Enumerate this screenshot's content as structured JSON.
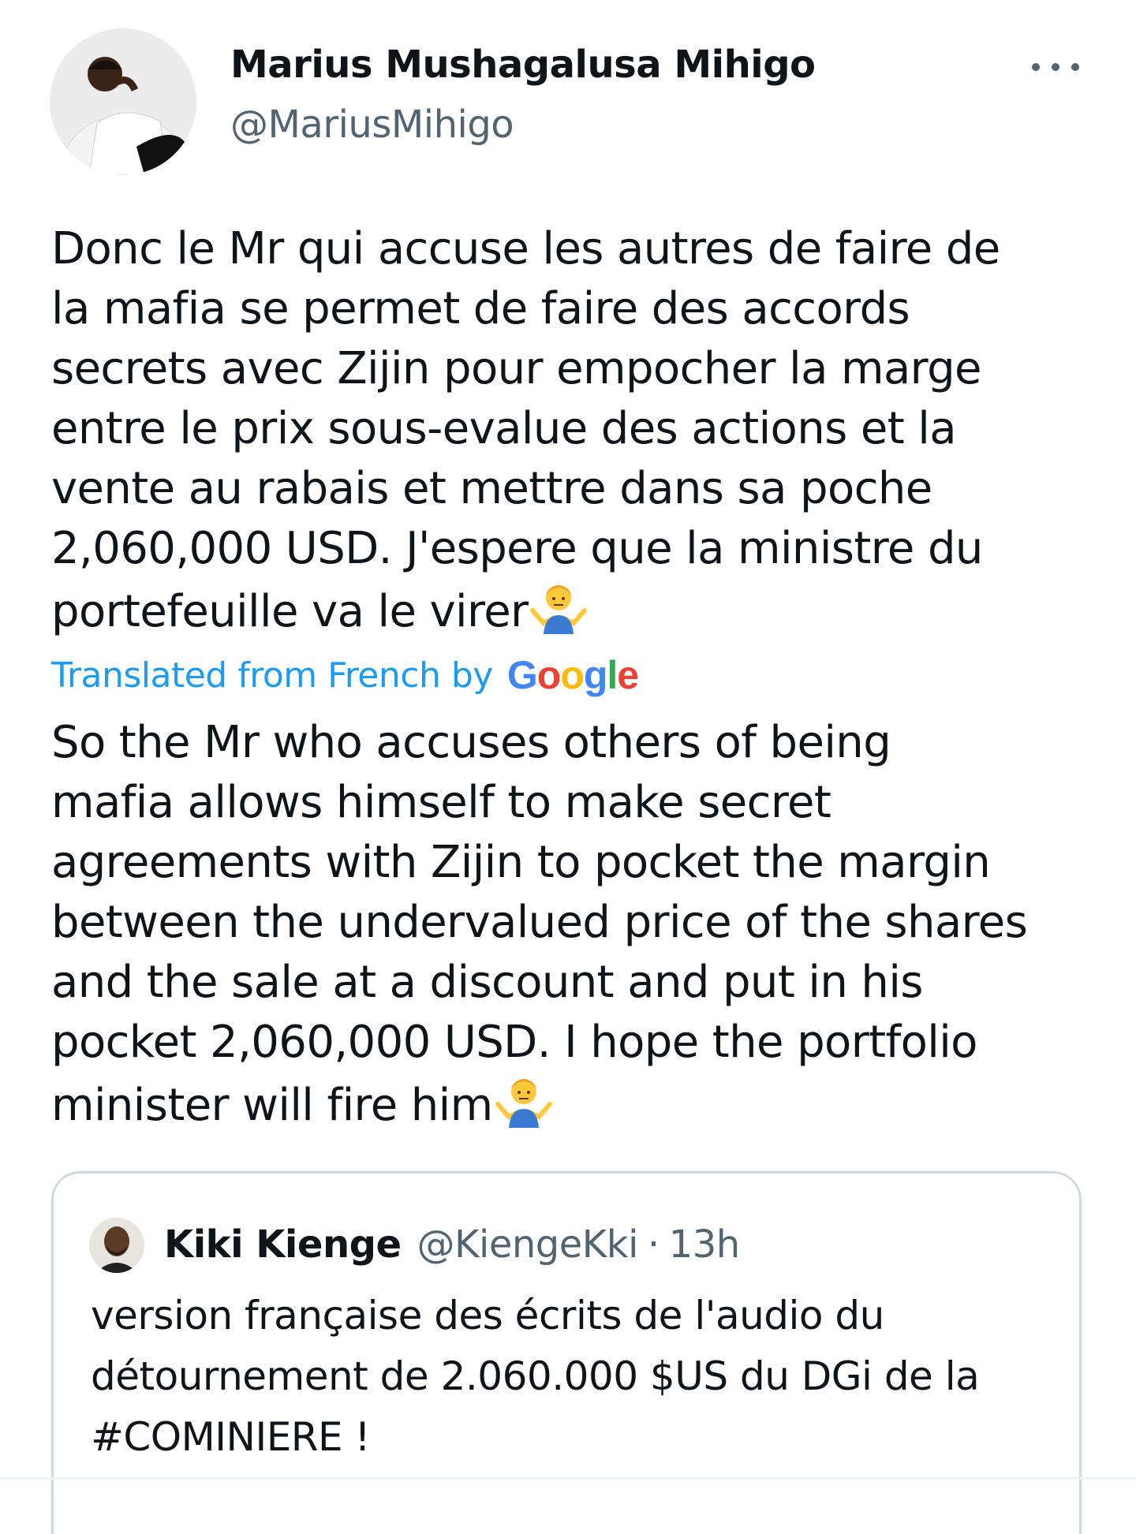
{
  "tweet": {
    "author_name": "Marius Mushagalusa Mihigo",
    "author_handle": "@MariusMihigo",
    "more_icon": "ellipsis-icon",
    "original_text": "Donc le Mr qui accuse les autres de faire de\nla mafia se permet de faire des accords\nsecrets avec Zijin pour empocher la marge\nentre le prix sous-evalue des actions et la\nvente au rabais et mettre dans sa poche\n2,060,000 USD. J'espere que la ministre du\nportefeuille va le virer",
    "translation_label": "Translated from French by",
    "google_logo": {
      "letters": [
        "G",
        "o",
        "o",
        "g",
        "l",
        "e"
      ],
      "colors": [
        "#4285F4",
        "#EA4335",
        "#FBBC05",
        "#4285F4",
        "#34A853",
        "#EA4335"
      ]
    },
    "translated_text": "So the Mr who accuses others of being\nmafia allows himself to make secret\nagreements with Zijin to pocket the margin\nbetween the undervalued price of the shares\nand the sale at a discount and put in his\npocket 2,060,000 USD. I hope the portfolio\nminister will fire him",
    "emoji_icon": "man-shrugging-emoji"
  },
  "quoted_tweet": {
    "author_name": "Kiki Kienge",
    "author_handle": "@KiengeKki",
    "separator": "·",
    "time": "13h",
    "text": "version française des écrits de l'audio du\ndétournement de 2.060.000 $US du DGi de la\n#COMINIERE !"
  },
  "colors": {
    "text_primary": "#0f1419",
    "text_secondary": "#536471",
    "link_blue": "#1d9bf0",
    "border": "#cfd9de"
  }
}
